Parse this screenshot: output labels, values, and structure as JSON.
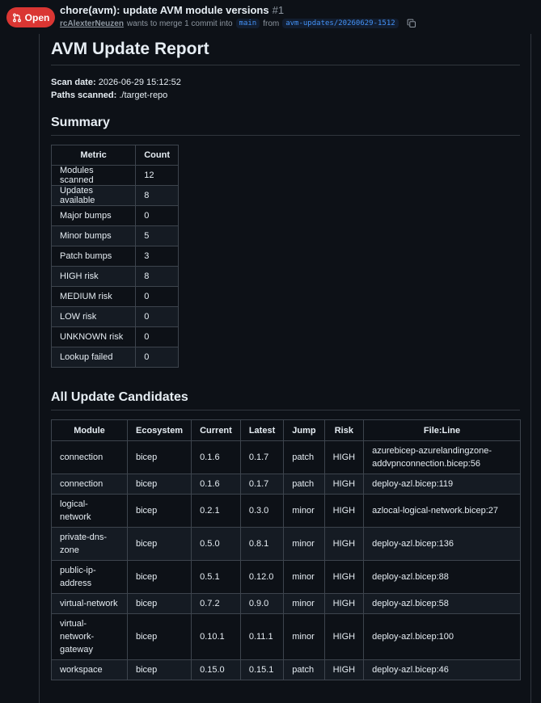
{
  "pr": {
    "state": "Open",
    "title": "chore(avm): update AVM module versions",
    "number": "#1",
    "author": "rcAlexterNeuzen",
    "merge_text": "wants to merge 1 commit into",
    "base_branch": "main",
    "from_text": "from",
    "head_branch": "avm-updates/20260629-1512"
  },
  "report": {
    "title": "AVM Update Report",
    "scan_date_label": "Scan date:",
    "scan_date": "2026-06-29 15:12:52",
    "paths_label": "Paths scanned:",
    "paths": "./target-repo",
    "summary_heading": "Summary",
    "summary_headers": [
      "Metric",
      "Count"
    ],
    "summary_rows": [
      [
        "Modules scanned",
        "12"
      ],
      [
        "Updates available",
        "8"
      ],
      [
        "Major bumps",
        "0"
      ],
      [
        "Minor bumps",
        "5"
      ],
      [
        "Patch bumps",
        "3"
      ],
      [
        "HIGH risk",
        "8"
      ],
      [
        "MEDIUM risk",
        "0"
      ],
      [
        "LOW risk",
        "0"
      ],
      [
        "UNKNOWN risk",
        "0"
      ],
      [
        "Lookup failed",
        "0"
      ]
    ],
    "candidates_heading": "All Update Candidates",
    "candidates_headers": [
      "Module",
      "Ecosystem",
      "Current",
      "Latest",
      "Jump",
      "Risk",
      "File:Line"
    ],
    "candidates_rows": [
      [
        "connection",
        "bicep",
        "0.1.6",
        "0.1.7",
        "patch",
        "HIGH",
        "azurebicep-azurelandingzone-addvpnconnection.bicep:56"
      ],
      [
        "connection",
        "bicep",
        "0.1.6",
        "0.1.7",
        "patch",
        "HIGH",
        "deploy-azl.bicep:119"
      ],
      [
        "logical-network",
        "bicep",
        "0.2.1",
        "0.3.0",
        "minor",
        "HIGH",
        "azlocal-logical-network.bicep:27"
      ],
      [
        "private-dns-zone",
        "bicep",
        "0.5.0",
        "0.8.1",
        "minor",
        "HIGH",
        "deploy-azl.bicep:136"
      ],
      [
        "public-ip-address",
        "bicep",
        "0.5.1",
        "0.12.0",
        "minor",
        "HIGH",
        "deploy-azl.bicep:88"
      ],
      [
        "virtual-network",
        "bicep",
        "0.7.2",
        "0.9.0",
        "minor",
        "HIGH",
        "deploy-azl.bicep:58"
      ],
      [
        "virtual-network-gateway",
        "bicep",
        "0.10.1",
        "0.11.1",
        "minor",
        "HIGH",
        "deploy-azl.bicep:100"
      ],
      [
        "workspace",
        "bicep",
        "0.15.0",
        "0.15.1",
        "patch",
        "HIGH",
        "deploy-azl.bicep:46"
      ]
    ]
  },
  "colors": {
    "background": "#0d1117",
    "open_badge": "#da3633",
    "branch_link": "#4493f8",
    "border": "#3d444d"
  },
  "icons": {
    "state": "git-pull-request-icon",
    "copy": "copy-icon"
  }
}
